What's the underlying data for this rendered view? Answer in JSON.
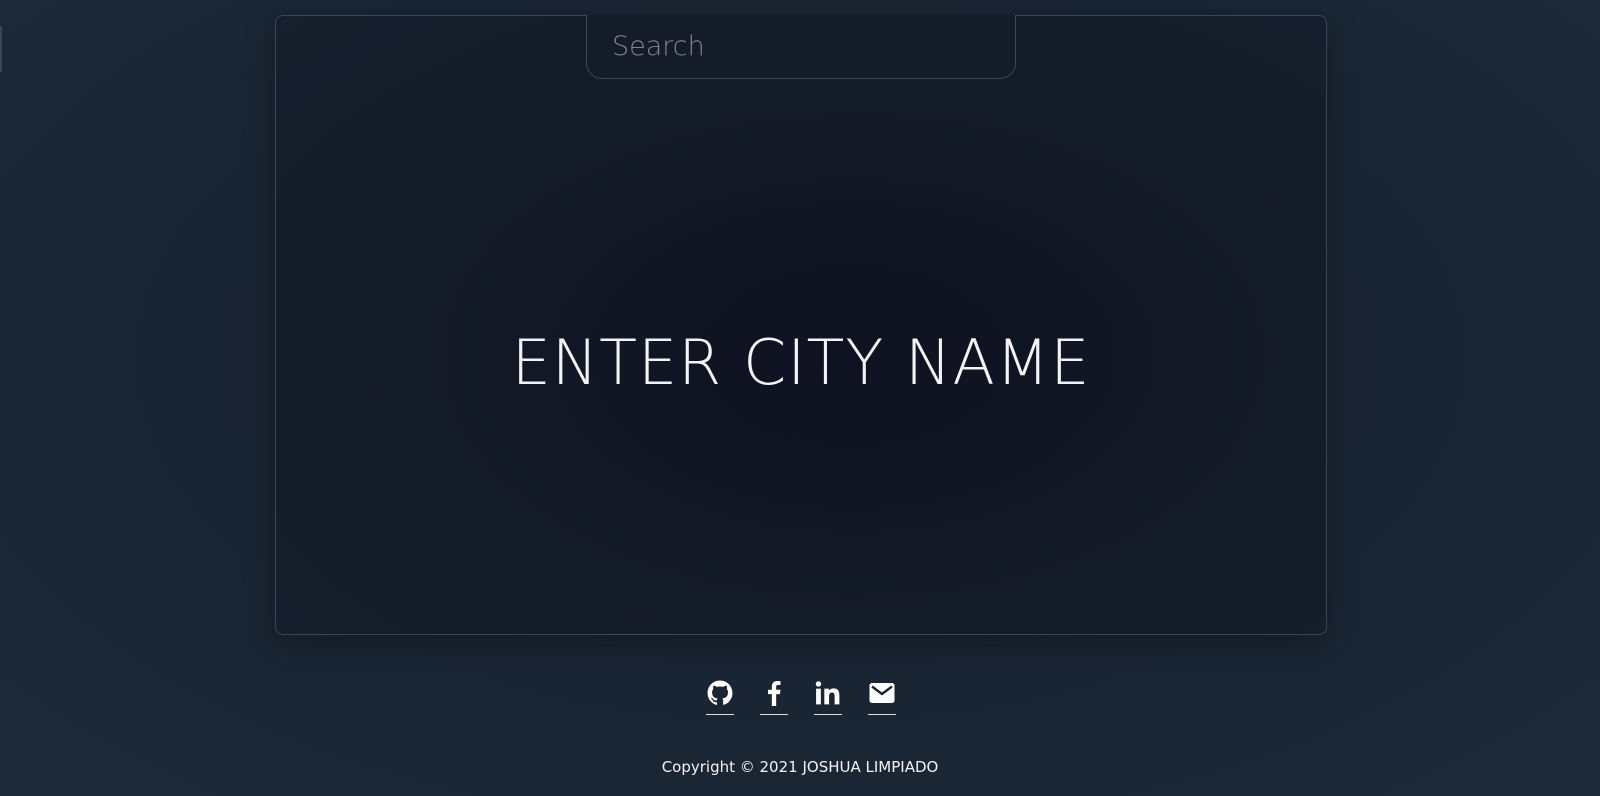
{
  "search": {
    "placeholder": "Search",
    "value": ""
  },
  "main": {
    "headline": "ENTER CITY NAME"
  },
  "social": [
    {
      "name": "github",
      "icon": "github-icon"
    },
    {
      "name": "facebook",
      "icon": "facebook-icon"
    },
    {
      "name": "linkedin",
      "icon": "linkedin-icon"
    },
    {
      "name": "email",
      "icon": "mail-icon"
    }
  ],
  "footer": {
    "copyright": "Copyright © 2021 JOSHUA LIMPIADO"
  },
  "colors": {
    "background": "#1a2533",
    "card_border": "#3a4656",
    "text": "#f2f2f5",
    "placeholder": "#7e8590"
  }
}
